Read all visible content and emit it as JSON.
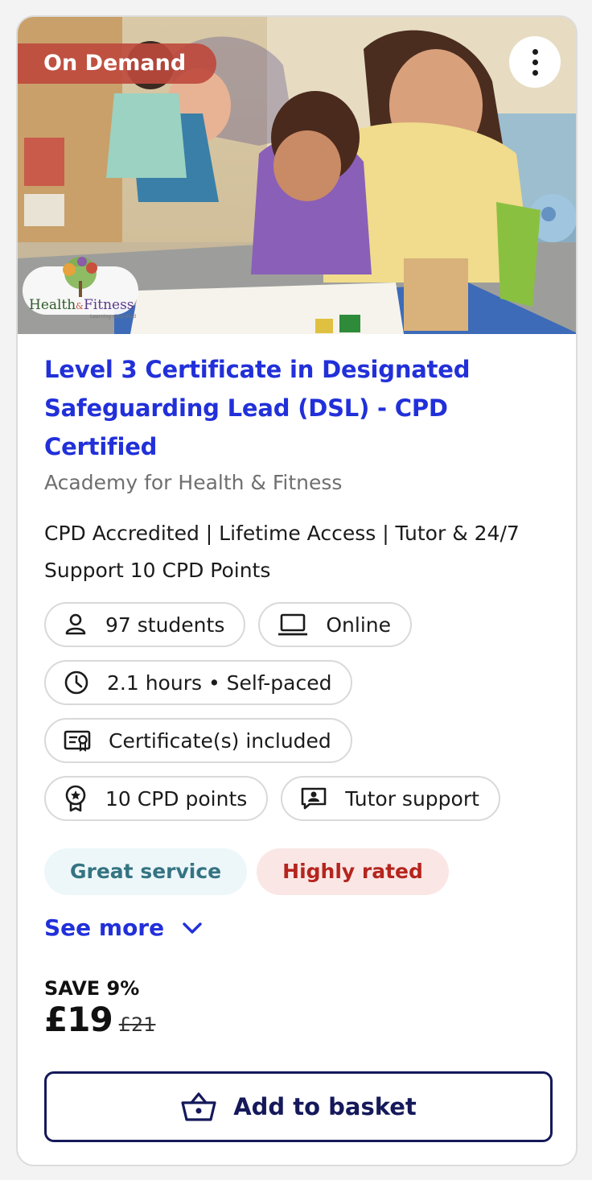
{
  "card": {
    "badge": "On Demand",
    "logo_text": {
      "line1": "Health",
      "amp": "&",
      "line2": "Fitness",
      "tagline": "Learning simplified"
    },
    "title": "Level 3 Certificate in Designated Safeguarding Lead (DSL) - CPD Certified",
    "provider": "Academy for Health & Fitness",
    "description": "CPD Accredited | Lifetime Access | Tutor & 24/7 Support 10 CPD Points",
    "chips": [
      {
        "icon": "person-icon",
        "label": "97 students"
      },
      {
        "icon": "laptop-icon",
        "label": "Online"
      },
      {
        "icon": "clock-icon",
        "label": "2.1 hours • Self-paced"
      },
      {
        "icon": "certificate-icon",
        "label": "Certificate(s) included"
      },
      {
        "icon": "award-icon",
        "label": "10 CPD points"
      },
      {
        "icon": "tutor-support-icon",
        "label": "Tutor support"
      }
    ],
    "tags": [
      {
        "label": "Great service",
        "color": "#357482",
        "background": "#edf7fa"
      },
      {
        "label": "Highly rated",
        "color": "#b5251e",
        "background": "#fae7e5"
      }
    ],
    "see_more": "See more",
    "save_label": "SAVE 9%",
    "price": "£19",
    "original_price": "£21",
    "add_to_basket": "Add to basket"
  },
  "colors": {
    "title_link": "#2130d9",
    "button_border": "#15195a",
    "badge_bg": "#be483c"
  }
}
